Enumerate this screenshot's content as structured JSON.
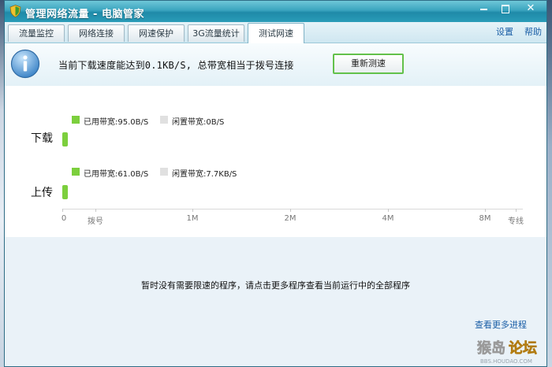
{
  "window": {
    "title": "管理网络流量 - 电脑管家"
  },
  "tabs": [
    {
      "label": "流量监控",
      "active": false
    },
    {
      "label": "网络连接",
      "active": false
    },
    {
      "label": "网速保护",
      "active": false
    },
    {
      "label": "3G流量统计",
      "active": false
    },
    {
      "label": "测试网速",
      "active": true
    }
  ],
  "links": {
    "settings": "设置",
    "help": "帮助"
  },
  "info": {
    "message": "当前下载速度能达到0.1KB/S, 总带宽相当于拨号连接",
    "retest_button": "重新测速"
  },
  "speed_test": {
    "download": {
      "label": "下载",
      "used_label": "已用带宽:95.0B/S",
      "idle_label": "闲置带宽:0B/S",
      "fraction_of_scale": 0.012
    },
    "upload": {
      "label": "上传",
      "used_label": "已用带宽:61.0B/S",
      "idle_label": "闲置带宽:7.7KB/S",
      "fraction_of_scale": 0.012
    },
    "scale_ticks": [
      "0",
      "拨号",
      "1M",
      "2M",
      "4M",
      "8M",
      "专线"
    ]
  },
  "processes": {
    "empty_message": "暂时没有需要限速的程序，请点击更多程序查看当前运行中的全部程序",
    "more_link": "查看更多进程"
  },
  "watermark": {
    "main": "猴岛论坛",
    "url": "BBS.HOUDAO.COM"
  },
  "colors": {
    "used": "#7ccf3d",
    "idle": "#e0e0e0",
    "titlebar": "#2a9cb8",
    "accent_border": "#63c14b"
  }
}
